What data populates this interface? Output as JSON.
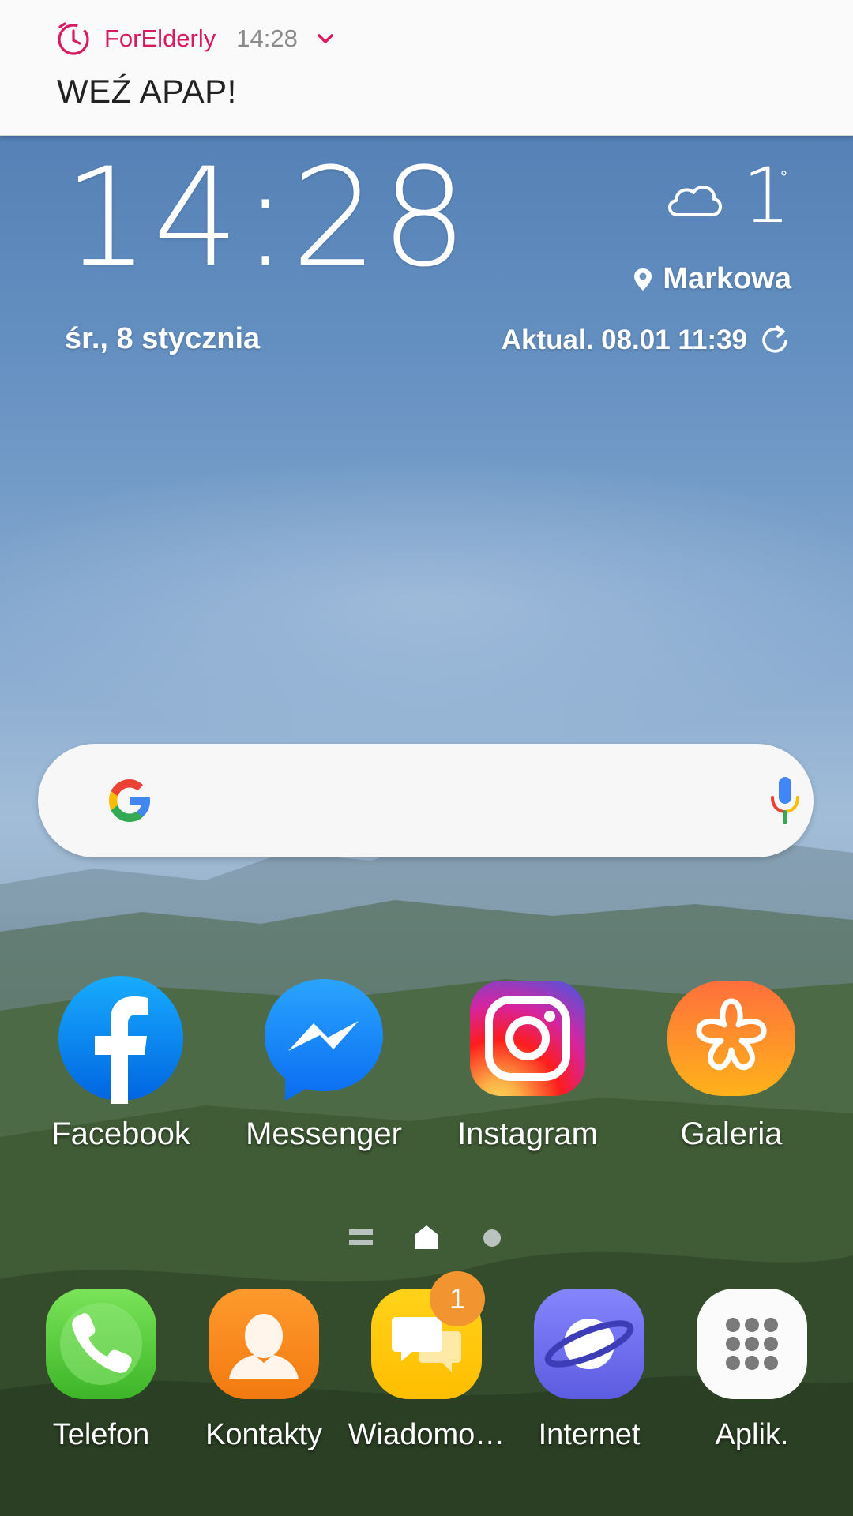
{
  "notification": {
    "app_name": "ForElderly",
    "time": "14:28",
    "message": "WEŹ APAP!",
    "icon": "alarm-clock-icon",
    "accent": "#d81b60"
  },
  "clock_widget": {
    "time": "14:28",
    "date": "śr., 8 stycznia"
  },
  "weather_widget": {
    "icon": "cloud-icon",
    "temperature": "1",
    "degree": "°",
    "location": "Markowa",
    "updated": "Aktual. 08.01 11:39"
  },
  "search_bar": {
    "left_icon": "google-g-icon",
    "right_icon": "microphone-icon"
  },
  "apps": [
    {
      "label": "Facebook",
      "icon": "facebook-icon",
      "color": "#1877f2"
    },
    {
      "label": "Messenger",
      "icon": "messenger-icon",
      "color": "#0a84ff"
    },
    {
      "label": "Instagram",
      "icon": "instagram-icon",
      "color": "#d6249f"
    },
    {
      "label": "Galeria",
      "icon": "gallery-flower-icon",
      "color": "#ff8a22"
    }
  ],
  "page_indicator": {
    "pages": [
      "menu-page",
      "home-page",
      "page-2"
    ],
    "active": "home-page"
  },
  "dock": [
    {
      "label": "Telefon",
      "icon": "phone-icon",
      "color": "#5ccb3f"
    },
    {
      "label": "Kontakty",
      "icon": "contacts-icon",
      "color": "#f78a1f"
    },
    {
      "label": "Wiadomo…",
      "icon": "messages-icon",
      "color": "#ffc800",
      "badge": "1"
    },
    {
      "label": "Internet",
      "icon": "internet-browser-icon",
      "color": "#6f6ff0"
    },
    {
      "label": "Aplik.",
      "icon": "apps-grid-icon",
      "color": "#ffffff"
    }
  ]
}
